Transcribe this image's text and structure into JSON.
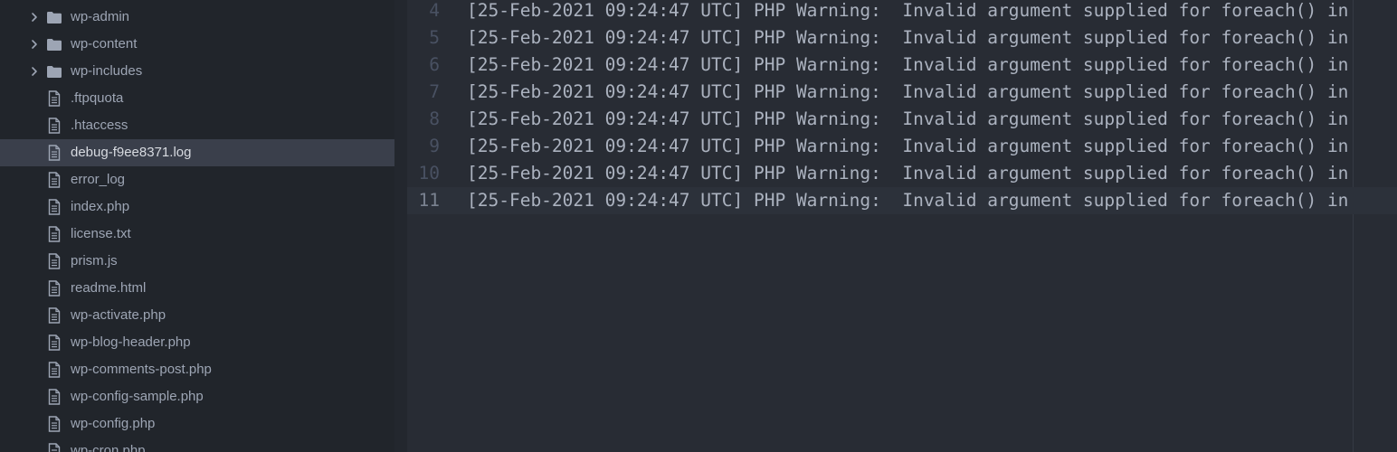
{
  "tree": {
    "items": [
      {
        "label": "wp-admin",
        "type": "folder",
        "icon": "folder-icon",
        "expandable": true,
        "selected": false
      },
      {
        "label": "wp-content",
        "type": "folder",
        "icon": "folder-icon",
        "expandable": true,
        "selected": false
      },
      {
        "label": "wp-includes",
        "type": "folder",
        "icon": "folder-icon",
        "expandable": true,
        "selected": false
      },
      {
        "label": ".ftpquota",
        "type": "file",
        "icon": "file-text-icon",
        "expandable": false,
        "selected": false
      },
      {
        "label": ".htaccess",
        "type": "file",
        "icon": "file-text-icon",
        "expandable": false,
        "selected": false
      },
      {
        "label": "debug-f9ee8371.log",
        "type": "file",
        "icon": "file-text-icon",
        "expandable": false,
        "selected": true
      },
      {
        "label": "error_log",
        "type": "file",
        "icon": "file-text-icon",
        "expandable": false,
        "selected": false
      },
      {
        "label": "index.php",
        "type": "file",
        "icon": "file-text-icon",
        "expandable": false,
        "selected": false
      },
      {
        "label": "license.txt",
        "type": "file",
        "icon": "file-text-icon",
        "expandable": false,
        "selected": false
      },
      {
        "label": "prism.js",
        "type": "file",
        "icon": "file-text-icon",
        "expandable": false,
        "selected": false
      },
      {
        "label": "readme.html",
        "type": "file",
        "icon": "file-text-icon",
        "expandable": false,
        "selected": false
      },
      {
        "label": "wp-activate.php",
        "type": "file",
        "icon": "file-text-icon",
        "expandable": false,
        "selected": false
      },
      {
        "label": "wp-blog-header.php",
        "type": "file",
        "icon": "file-text-icon",
        "expandable": false,
        "selected": false
      },
      {
        "label": "wp-comments-post.php",
        "type": "file",
        "icon": "file-text-icon",
        "expandable": false,
        "selected": false
      },
      {
        "label": "wp-config-sample.php",
        "type": "file",
        "icon": "file-text-icon",
        "expandable": false,
        "selected": false
      },
      {
        "label": "wp-config.php",
        "type": "file",
        "icon": "file-text-icon",
        "expandable": false,
        "selected": false
      },
      {
        "label": "wp-cron.php",
        "type": "file",
        "icon": "file-text-icon",
        "expandable": false,
        "selected": false
      }
    ]
  },
  "editor": {
    "lines": [
      {
        "number": "4",
        "text": "[25-Feb-2021 09:24:47 UTC] PHP Warning:  Invalid argument supplied for foreach() in",
        "current": false
      },
      {
        "number": "5",
        "text": "[25-Feb-2021 09:24:47 UTC] PHP Warning:  Invalid argument supplied for foreach() in",
        "current": false
      },
      {
        "number": "6",
        "text": "[25-Feb-2021 09:24:47 UTC] PHP Warning:  Invalid argument supplied for foreach() in",
        "current": false
      },
      {
        "number": "7",
        "text": "[25-Feb-2021 09:24:47 UTC] PHP Warning:  Invalid argument supplied for foreach() in",
        "current": false
      },
      {
        "number": "8",
        "text": "[25-Feb-2021 09:24:47 UTC] PHP Warning:  Invalid argument supplied for foreach() in",
        "current": false
      },
      {
        "number": "9",
        "text": "[25-Feb-2021 09:24:47 UTC] PHP Warning:  Invalid argument supplied for foreach() in",
        "current": false
      },
      {
        "number": "10",
        "text": "[25-Feb-2021 09:24:47 UTC] PHP Warning:  Invalid argument supplied for foreach() in",
        "current": false
      },
      {
        "number": "11",
        "text": "[25-Feb-2021 09:24:47 UTC] PHP Warning:  Invalid argument supplied for foreach() in",
        "current": true
      }
    ]
  },
  "colors": {
    "sidebar_bg": "#21252b",
    "editor_bg": "#282c34",
    "selected_row": "#3a3f4b",
    "text": "#abb2bf",
    "line_number": "#495162"
  }
}
